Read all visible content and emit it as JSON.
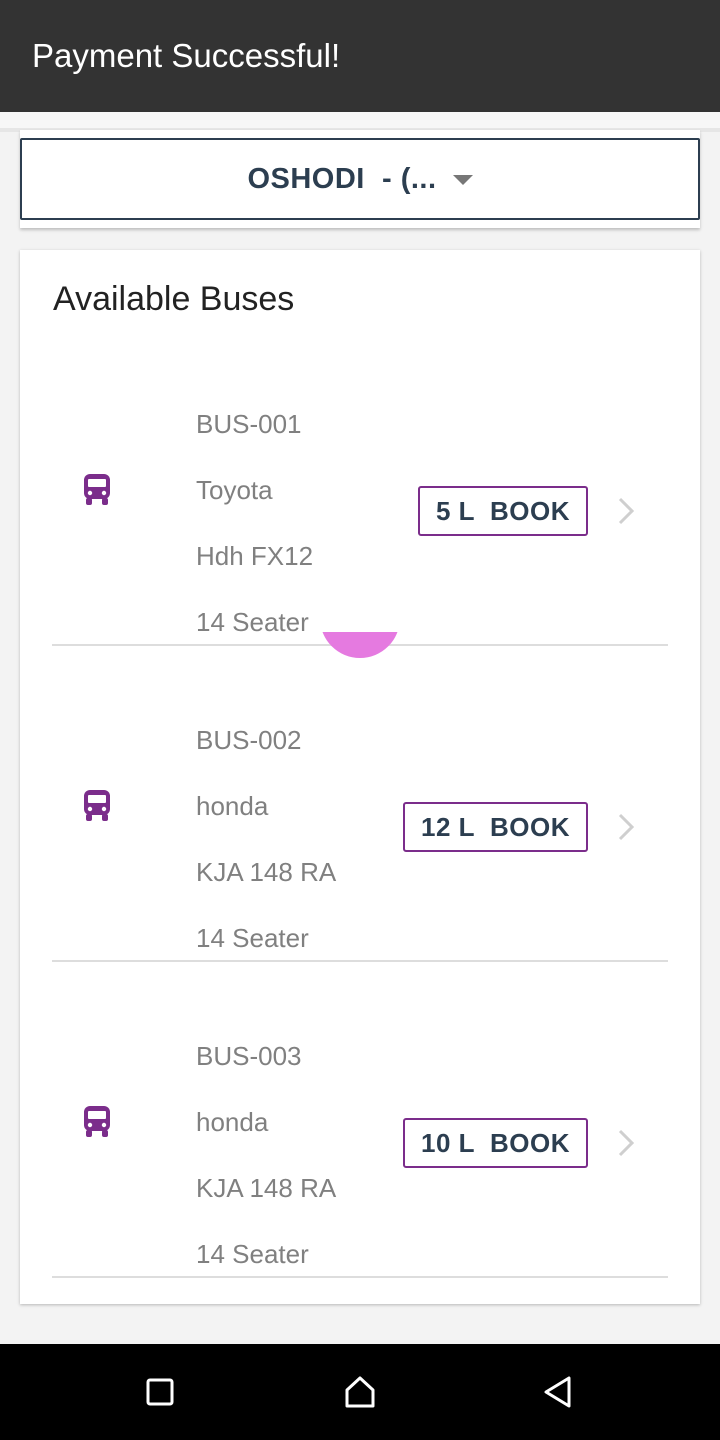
{
  "toast": {
    "message": "Payment Successful!"
  },
  "route_select": {
    "value": "OSHODI  - (..."
  },
  "buses_card": {
    "title": "Available Buses",
    "items": [
      {
        "code": "BUS-001",
        "make": "Toyota",
        "plate": "Hdh FX12",
        "capacity": "14 Seater",
        "book_label": "5 L  BOOK"
      },
      {
        "code": "BUS-002",
        "make": "honda",
        "plate": "KJA 148 RA",
        "capacity": "14 Seater",
        "book_label": "12 L  BOOK"
      },
      {
        "code": "BUS-003",
        "make": "honda",
        "plate": "KJA 148 RA",
        "capacity": "14 Seater",
        "book_label": "10 L  BOOK"
      }
    ]
  },
  "colors": {
    "accent": "#7b2d8b",
    "ripple": "#e57ae0",
    "toast_bg": "#333333",
    "text_primary": "#2c3e50"
  },
  "icons": {
    "bus": "bus-icon",
    "chevron": "chevron-right-icon",
    "caret": "caret-down-icon",
    "nav_recent": "recent-apps-icon",
    "nav_home": "home-icon",
    "nav_back": "back-icon"
  }
}
